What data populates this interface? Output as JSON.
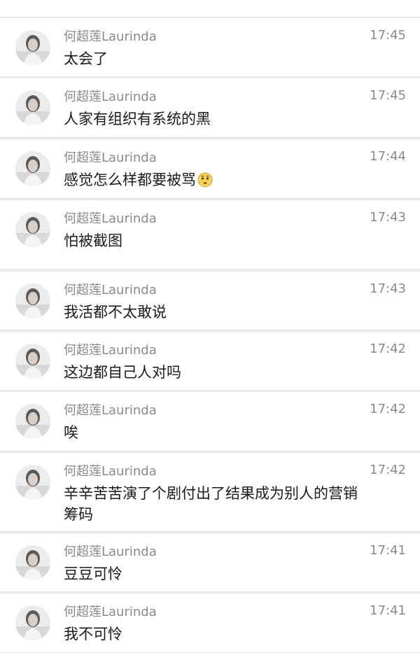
{
  "messages": [
    {
      "sender": "何超莲Laurinda",
      "time": "17:45",
      "text": "太会了"
    },
    {
      "sender": "何超莲Laurinda",
      "time": "17:45",
      "text": "人家有组织有系统的黑"
    },
    {
      "sender": "何超莲Laurinda",
      "time": "17:44",
      "text": "感觉怎么样都要被骂",
      "emoji": "worried-face-icon"
    },
    {
      "sender": "何超莲Laurinda",
      "time": "17:43",
      "text": "怕被截图"
    },
    {
      "sender": "何超莲Laurinda",
      "time": "17:43",
      "text": "我活都不太敢说"
    },
    {
      "sender": "何超莲Laurinda",
      "time": "17:42",
      "text": "这边都自己人对吗"
    },
    {
      "sender": "何超莲Laurinda",
      "time": "17:42",
      "text": "唉"
    },
    {
      "sender": "何超莲Laurinda",
      "time": "17:42",
      "text": "辛辛苦苦演了个剧付出了结果成为别人的营销筹码"
    },
    {
      "sender": "何超莲Laurinda",
      "time": "17:41",
      "text": "豆豆可怜"
    },
    {
      "sender": "何超莲Laurinda",
      "time": "17:41",
      "text": "我不可怜"
    }
  ],
  "colors": {
    "background": "#f2f2f2",
    "row": "#ffffff",
    "meta_text": "#8a8a8a",
    "message_text": "#1a1a1a"
  }
}
